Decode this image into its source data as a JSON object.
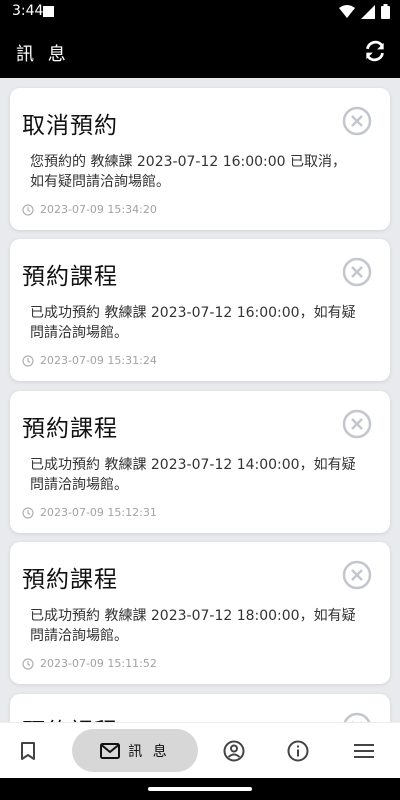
{
  "status_bar": {
    "time": "3:44"
  },
  "app_bar": {
    "title": "訊 息"
  },
  "messages": [
    {
      "title": "取消預約",
      "body": "您預約的 教練課 2023-07-12 16:00:00 已取消，如有疑問請洽詢場館。",
      "timestamp": "2023-07-09 15:34:20"
    },
    {
      "title": "預約課程",
      "body": "已成功預約 教練課 2023-07-12 16:00:00，如有疑問請洽詢場館。",
      "timestamp": "2023-07-09 15:31:24"
    },
    {
      "title": "預約課程",
      "body": "已成功預約 教練課 2023-07-12 14:00:00，如有疑問請洽詢場館。",
      "timestamp": "2023-07-09 15:12:31"
    },
    {
      "title": "預約課程",
      "body": "已成功預約 教練課 2023-07-12 18:00:00，如有疑問請洽詢場館。",
      "timestamp": "2023-07-09 15:11:52"
    },
    {
      "title": "預約課程",
      "body": "",
      "timestamp": ""
    }
  ],
  "bottom_nav": {
    "messages_label": "訊 息"
  }
}
